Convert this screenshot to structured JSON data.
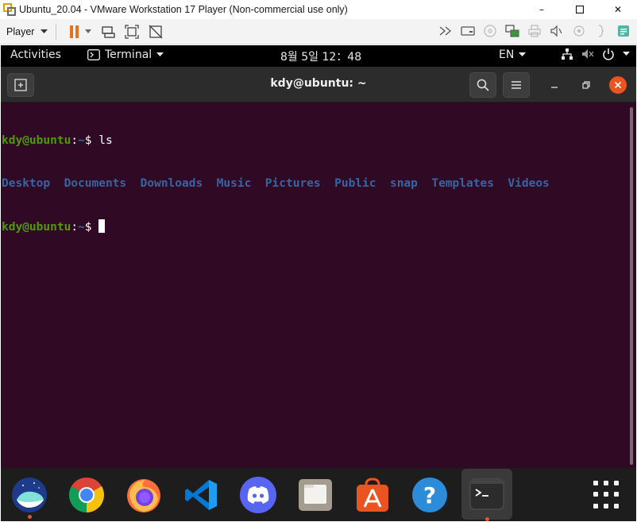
{
  "window": {
    "title": "Ubuntu_20.04 - VMware Workstation 17 Player (Non-commercial use only)",
    "minimize_glyph": "–",
    "maximize_glyph": "☐",
    "close_glyph": "✕"
  },
  "toolbar": {
    "player_label": "Player",
    "icons": [
      "pause-icon",
      "send-ctrl-alt-del-icon",
      "fit-guest-icon",
      "unity-icon",
      "fast-forward-icon",
      "hdd-icon",
      "cd-icon",
      "network-icon",
      "printer-icon",
      "sound-icon",
      "usb-icon",
      "more-icon",
      "message-icon"
    ]
  },
  "gnome_bar": {
    "activities": "Activities",
    "app_name": "Terminal",
    "clock": "8월 5일  12：48",
    "lang": "EN",
    "tray_icons": [
      "network-wired-icon",
      "volume-muted-icon",
      "power-icon"
    ]
  },
  "terminal": {
    "title": "kdy@ubuntu: ~",
    "lines": [
      {
        "user": "kdy@ubuntu",
        "sep": ":",
        "path": "~",
        "dollar": "$ ",
        "cmd": "ls"
      },
      {
        "dirs": [
          "Desktop",
          "Documents",
          "Downloads",
          "Music",
          "Pictures",
          "Public",
          "snap",
          "Templates",
          "Videos"
        ]
      },
      {
        "user": "kdy@ubuntu",
        "sep": ":",
        "path": "~",
        "dollar": "$ ",
        "cmd": ""
      }
    ]
  },
  "dock": {
    "apps": [
      {
        "name": "Cinnamon-like app",
        "icon": "whale-icon",
        "running": true
      },
      {
        "name": "Google Chrome",
        "icon": "chrome-icon",
        "running": false
      },
      {
        "name": "Firefox",
        "icon": "firefox-icon",
        "running": false
      },
      {
        "name": "Visual Studio Code",
        "icon": "vscode-icon",
        "running": false
      },
      {
        "name": "Discord",
        "icon": "discord-icon",
        "running": false
      },
      {
        "name": "Files",
        "icon": "files-icon",
        "running": false
      },
      {
        "name": "Ubuntu Software",
        "icon": "software-icon",
        "running": false
      },
      {
        "name": "Help",
        "icon": "help-icon",
        "running": false
      },
      {
        "name": "Terminal",
        "icon": "terminal-icon",
        "running": true
      }
    ]
  },
  "colors": {
    "terminal_bg": "#300a24",
    "prompt_user": "#4e9a06",
    "prompt_path": "#3465a4",
    "accent": "#e95420"
  }
}
